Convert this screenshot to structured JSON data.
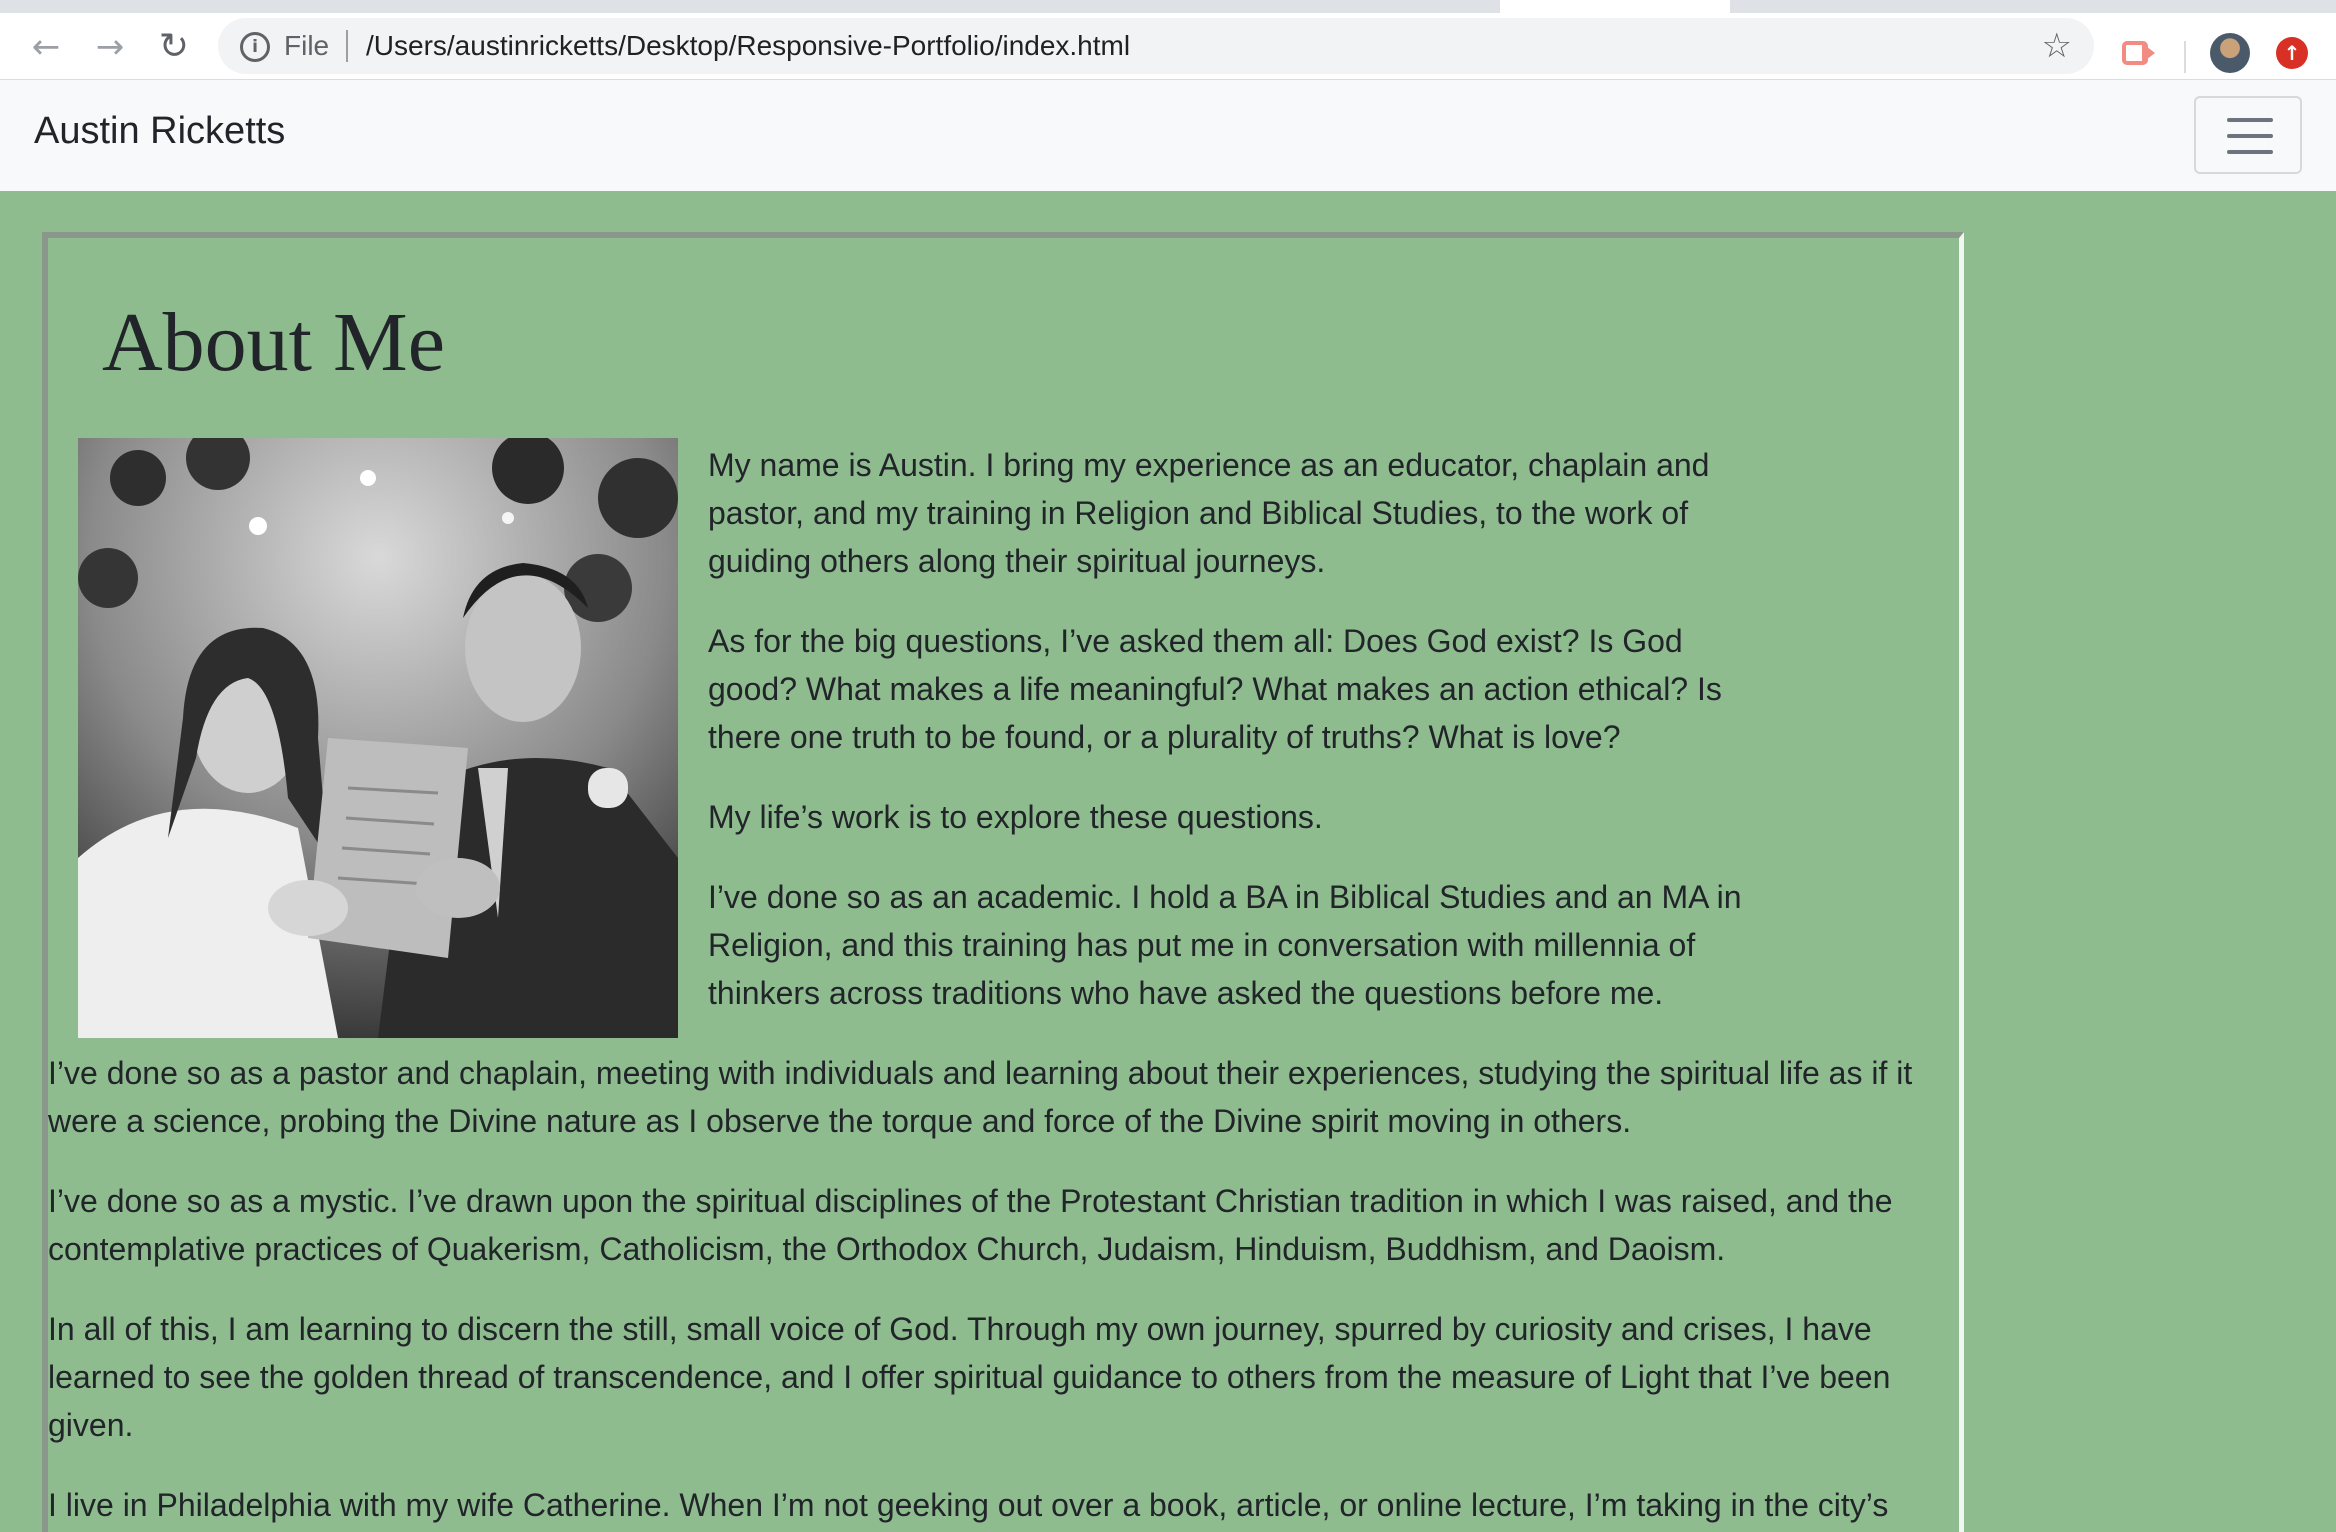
{
  "browser": {
    "nav": {
      "back": "←",
      "forward": "→",
      "reload": "↻"
    },
    "omnibox": {
      "scheme_label": "File",
      "url": "/Users/austinricketts/Desktop/Responsive-Portfolio/index.html"
    },
    "icons": {
      "info": "i",
      "bookmark": "☆",
      "extension": "cast-extension-icon",
      "profile": "profile-avatar",
      "update": "↑"
    }
  },
  "navbar": {
    "brand": "Austin Ricketts",
    "toggler_icon": "hamburger-menu-icon"
  },
  "about": {
    "heading": "About Me",
    "photo_alt": "Black and white photo of a couple singing from a program",
    "paragraphs": [
      "My name is Austin. I bring my experience as an educator, chaplain and pastor, and my training in Religion and Biblical Studies, to the work of guiding others along their spiritual journeys.",
      "As for the big questions, I’ve asked them all: Does God exist? Is God good? What makes a life meaningful? What makes an action ethical? Is there one truth to be found, or a plurality of truths? What is love?",
      "My life’s work is to explore these questions.",
      "I’ve done so as an academic. I hold a BA in Biblical Studies and an MA in Religion, and this training has put me in conversation with millennia of thinkers across traditions who have asked the questions before me.",
      "I’ve done so as a pastor and chaplain, meeting with individuals and learning about their experiences, studying the spiritual life as if it were a science, probing the Divine nature as I observe the torque and force of the Divine spirit moving in others.",
      "I’ve done so as a mystic. I’ve drawn upon the spiritual disciplines of the Protestant Christian tradition in which I was raised, and the contemplative practices of Quakerism, Catholicism, the Orthodox Church, Judaism, Hinduism, Buddhism, and Daoism.",
      "In all of this, I am learning to discern the still, small voice of God. Through my own journey, spurred by curiosity and crises, I have learned to see the golden thread of transcendence, and I offer spiritual guidance to others from the measure of Light that I’ve been given.",
      "I live in Philadelphia with my wife Catherine. When I’m not geeking out over a book, article, or online lecture, I’m taking in the city’s"
    ]
  },
  "colors": {
    "page_background": "#8fbc8f",
    "navbar_background": "#f8f9fa",
    "text": "#212529"
  }
}
